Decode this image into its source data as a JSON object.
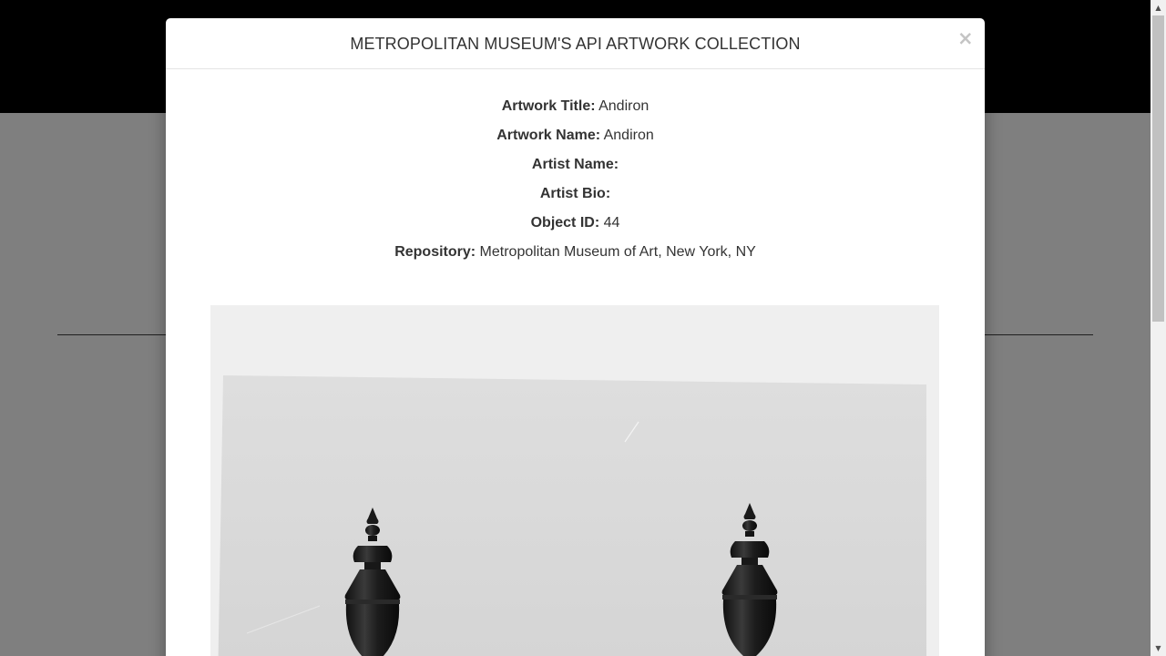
{
  "modal": {
    "title": "METROPOLITAN MUSEUM'S API ARTWORK COLLECTION",
    "close_symbol": "×",
    "close_icon": "close-icon",
    "details": [
      {
        "label": "Artwork Title:",
        "value": "Andiron"
      },
      {
        "label": "Artwork Name:",
        "value": "Andiron"
      },
      {
        "label": "Artist Name:",
        "value": ""
      },
      {
        "label": "Artist Bio:",
        "value": ""
      },
      {
        "label": "Object ID:",
        "value": "44"
      },
      {
        "label": "Repository:",
        "value": "Metropolitan Museum of Art, New York, NY"
      }
    ],
    "artwork_image": "andiron-photograph"
  },
  "colors": {
    "page_header": "#000000",
    "overlay_background": "#7f7f7f",
    "modal_background": "#ffffff",
    "text": "#333333",
    "close_icon": "#c4c4c4"
  },
  "scrollbar": {
    "up_icon": "scroll-up-arrow-icon",
    "down_icon": "scroll-down-arrow-icon"
  }
}
